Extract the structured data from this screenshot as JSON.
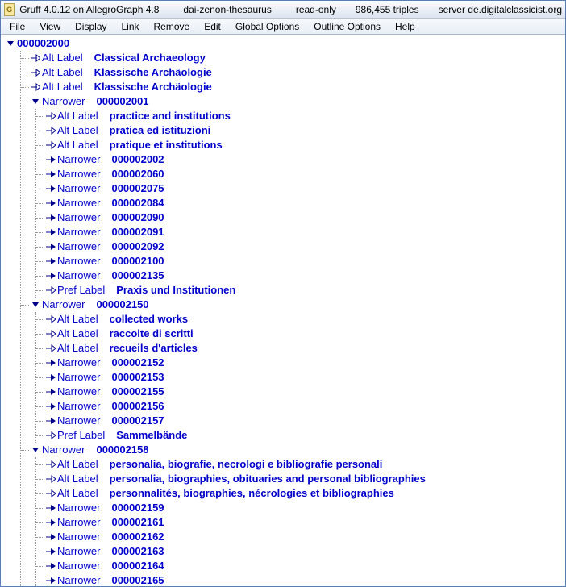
{
  "titlebar": {
    "app": "Gruff 4.0.12 on AllegroGraph 4.8",
    "db": "dai-zenon-thesaurus",
    "mode": "read-only",
    "triples": "986,455 triples",
    "server": "server de.digitalclassicist.org"
  },
  "menu": [
    "File",
    "View",
    "Display",
    "Link",
    "Remove",
    "Edit",
    "Global Options",
    "Outline Options",
    "Help"
  ],
  "tree": {
    "root": "000002000",
    "children": [
      {
        "t": "leaf",
        "pred": "Alt Label",
        "val": "Classical Archaeology"
      },
      {
        "t": "leaf",
        "pred": "Alt Label",
        "val": "Klassische Archäologie"
      },
      {
        "t": "leaf",
        "pred": "Alt Label",
        "val": "Klassische Archäologie"
      },
      {
        "t": "open",
        "pred": "Narrower",
        "val": "000002001",
        "children": [
          {
            "t": "leaf",
            "pred": "Alt Label",
            "val": "practice and institutions"
          },
          {
            "t": "leaf",
            "pred": "Alt Label",
            "val": "pratica ed istituzioni"
          },
          {
            "t": "leaf",
            "pred": "Alt Label",
            "val": "pratique et institutions"
          },
          {
            "t": "closed",
            "pred": "Narrower",
            "val": "000002002"
          },
          {
            "t": "closed",
            "pred": "Narrower",
            "val": "000002060"
          },
          {
            "t": "closed",
            "pred": "Narrower",
            "val": "000002075"
          },
          {
            "t": "closed",
            "pred": "Narrower",
            "val": "000002084"
          },
          {
            "t": "closed",
            "pred": "Narrower",
            "val": "000002090"
          },
          {
            "t": "closed",
            "pred": "Narrower",
            "val": "000002091"
          },
          {
            "t": "closed",
            "pred": "Narrower",
            "val": "000002092"
          },
          {
            "t": "closed",
            "pred": "Narrower",
            "val": "000002100"
          },
          {
            "t": "closed",
            "pred": "Narrower",
            "val": "000002135"
          },
          {
            "t": "leaf",
            "pred": "Pref Label",
            "val": "Praxis und Institutionen"
          }
        ]
      },
      {
        "t": "open",
        "pred": "Narrower",
        "val": "000002150",
        "children": [
          {
            "t": "leaf",
            "pred": "Alt Label",
            "val": "collected works"
          },
          {
            "t": "leaf",
            "pred": "Alt Label",
            "val": "raccolte di scritti"
          },
          {
            "t": "leaf",
            "pred": "Alt Label",
            "val": "recueils d'articles"
          },
          {
            "t": "closed",
            "pred": "Narrower",
            "val": "000002152"
          },
          {
            "t": "closed",
            "pred": "Narrower",
            "val": "000002153"
          },
          {
            "t": "closed",
            "pred": "Narrower",
            "val": "000002155"
          },
          {
            "t": "closed",
            "pred": "Narrower",
            "val": "000002156"
          },
          {
            "t": "closed",
            "pred": "Narrower",
            "val": "000002157"
          },
          {
            "t": "leaf",
            "pred": "Pref Label",
            "val": "Sammelbände"
          }
        ]
      },
      {
        "t": "open",
        "pred": "Narrower",
        "val": "000002158",
        "children": [
          {
            "t": "leaf",
            "pred": "Alt Label",
            "val": "personalia, biografie, necrologi e bibliografie personali"
          },
          {
            "t": "leaf",
            "pred": "Alt Label",
            "val": "personalia, biographies, obituaries and personal bibliographies"
          },
          {
            "t": "leaf",
            "pred": "Alt Label",
            "val": "personnalités, biographies, nécrologies et bibliographies"
          },
          {
            "t": "closed",
            "pred": "Narrower",
            "val": "000002159"
          },
          {
            "t": "closed",
            "pred": "Narrower",
            "val": "000002161"
          },
          {
            "t": "closed",
            "pred": "Narrower",
            "val": "000002162"
          },
          {
            "t": "closed",
            "pred": "Narrower",
            "val": "000002163"
          },
          {
            "t": "closed",
            "pred": "Narrower",
            "val": "000002164"
          },
          {
            "t": "closed",
            "pred": "Narrower",
            "val": "000002165"
          }
        ]
      }
    ]
  }
}
